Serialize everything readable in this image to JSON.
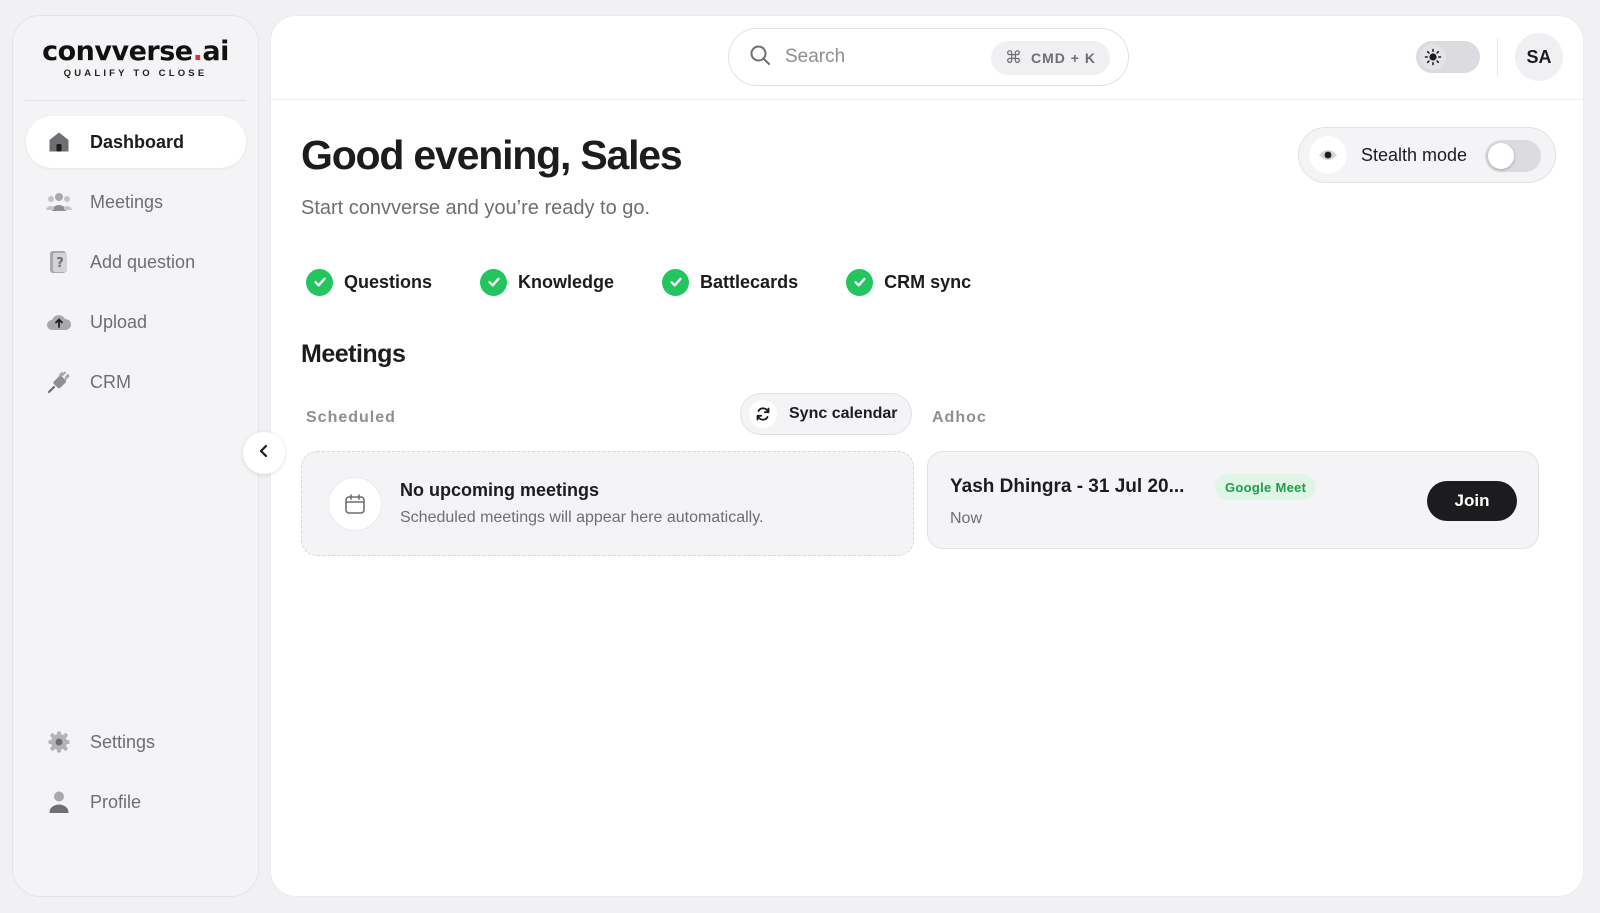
{
  "logo": {
    "name_main": "convverse",
    "name_dot": ".",
    "name_suffix": "ai",
    "tagline": "QUALIFY TO CLOSE",
    "accent": "#e0322f"
  },
  "sidebar": {
    "items": [
      {
        "label": "Dashboard",
        "icon": "home-icon",
        "active": true
      },
      {
        "label": "Meetings",
        "icon": "people-icon"
      },
      {
        "label": "Add question",
        "icon": "question-doc-icon"
      },
      {
        "label": "Upload",
        "icon": "cloud-upload-icon"
      },
      {
        "label": "CRM",
        "icon": "plug-icon"
      }
    ],
    "bottom_items": [
      {
        "label": "Settings",
        "icon": "gear-icon"
      },
      {
        "label": "Profile",
        "icon": "person-icon"
      }
    ]
  },
  "topbar": {
    "search_placeholder": "Search",
    "shortcut_symbol": "⌘",
    "shortcut": "CMD + K",
    "avatar_initials": "SA"
  },
  "greeting": "Good evening, Sales",
  "subtitle": "Start convverse and you’re ready to go.",
  "stealth": {
    "label": "Stealth mode",
    "enabled": false
  },
  "checklist": [
    {
      "label": "Questions",
      "done": true
    },
    {
      "label": "Knowledge",
      "done": true
    },
    {
      "label": "Battlecards",
      "done": true
    },
    {
      "label": "CRM sync",
      "done": true
    }
  ],
  "meetings": {
    "title": "Meetings",
    "scheduled_label": "Scheduled",
    "sync_label": "Sync calendar",
    "adhoc_label": "Adhoc",
    "empty_title": "No upcoming meetings",
    "empty_desc": "Scheduled meetings will appear here automatically.",
    "adhoc": [
      {
        "title": "Yash Dhingra - 31 Jul 20...",
        "platform": "Google Meet",
        "time": "Now",
        "action": "Join"
      }
    ]
  },
  "colors": {
    "success": "#22c55e",
    "dark": "#1c1c1e",
    "muted": "#6e6e73"
  }
}
